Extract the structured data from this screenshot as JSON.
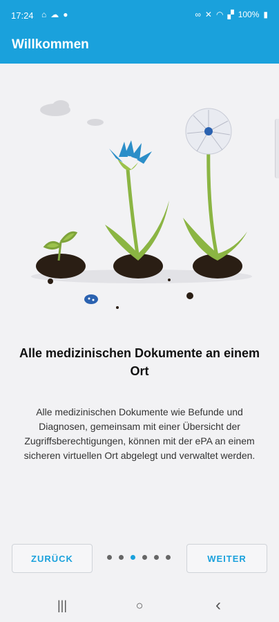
{
  "statusbar": {
    "time": "17:24",
    "battery": "100%",
    "left_icons": [
      "building-icon",
      "cloud-icon",
      "location-icon"
    ],
    "right_icons": [
      "link-icon",
      "mute-icon",
      "wifi-icon",
      "signal-icon",
      "battery-icon"
    ]
  },
  "appbar": {
    "title": "Willkommen",
    "color": "#1aa1dc"
  },
  "onboarding": {
    "headline": "Alle medizinischen Dokumente an einem Ort",
    "body": "Alle medizinischen Dokumente wie Befunde und Diagnosen, gemeinsam mit einer Übersicht der Zugriffsberechtigungen, können mit der ePA an einem sicheren virtuellen Ort abgelegt und verwaltet werden.",
    "pager": {
      "count": 6,
      "active_index": 2
    }
  },
  "buttons": {
    "back": "ZURÜCK",
    "next": "WEITER"
  },
  "navbar": {
    "recents": "|||",
    "home": "○",
    "back": "‹"
  }
}
